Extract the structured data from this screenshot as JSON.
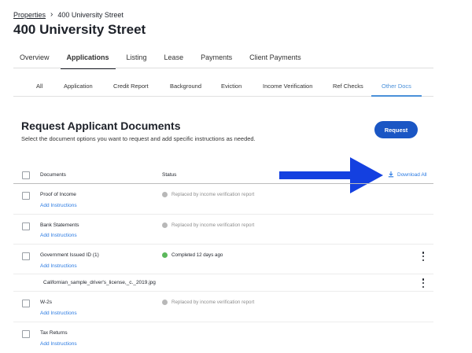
{
  "breadcrumb": {
    "parent": "Properties",
    "current": "400 University Street"
  },
  "page_title": "400 University Street",
  "tabs": [
    {
      "label": "Overview",
      "active": false
    },
    {
      "label": "Applications",
      "active": true
    },
    {
      "label": "Listing",
      "active": false
    },
    {
      "label": "Lease",
      "active": false
    },
    {
      "label": "Payments",
      "active": false
    },
    {
      "label": "Client Payments",
      "active": false
    }
  ],
  "subtabs": [
    {
      "label": "All",
      "active": false
    },
    {
      "label": "Application",
      "active": false
    },
    {
      "label": "Credit Report",
      "active": false
    },
    {
      "label": "Background",
      "active": false
    },
    {
      "label": "Eviction",
      "active": false
    },
    {
      "label": "Income Verification",
      "active": false
    },
    {
      "label": "Ref Checks",
      "active": false
    },
    {
      "label": "Other Docs",
      "active": true
    }
  ],
  "section": {
    "title": "Request Applicant Documents",
    "subtitle": "Select the document options you want to request and add specific instructions as needed.",
    "request_button": "Request"
  },
  "table": {
    "header_documents": "Documents",
    "header_status": "Status",
    "download_all": "Download All",
    "rows": [
      {
        "name": "Proof of Income",
        "add_instructions": "Add Instructions",
        "status": "Replaced by income verification report"
      },
      {
        "name": "Bank Statements",
        "add_instructions": "Add Instructions",
        "status": "Replaced by income verification report"
      },
      {
        "name": "Government Issued ID (1)",
        "add_instructions": "Add Instructions",
        "status": "Completed 12 days ago"
      },
      {
        "name": "W-2s",
        "add_instructions": "Add Instructions",
        "status": "Replaced by income verification report"
      },
      {
        "name": "Tax Returns",
        "add_instructions": "Add Instructions",
        "status": ""
      }
    ],
    "file": "Californian_sample_driver's_license,_c._2019.jpg"
  },
  "colors": {
    "accent": "#1a56c4",
    "link": "#2a7ae2",
    "annotation_arrow": "#1440e0",
    "status_complete": "#5cb85c",
    "status_replaced": "#b8b8b8"
  }
}
